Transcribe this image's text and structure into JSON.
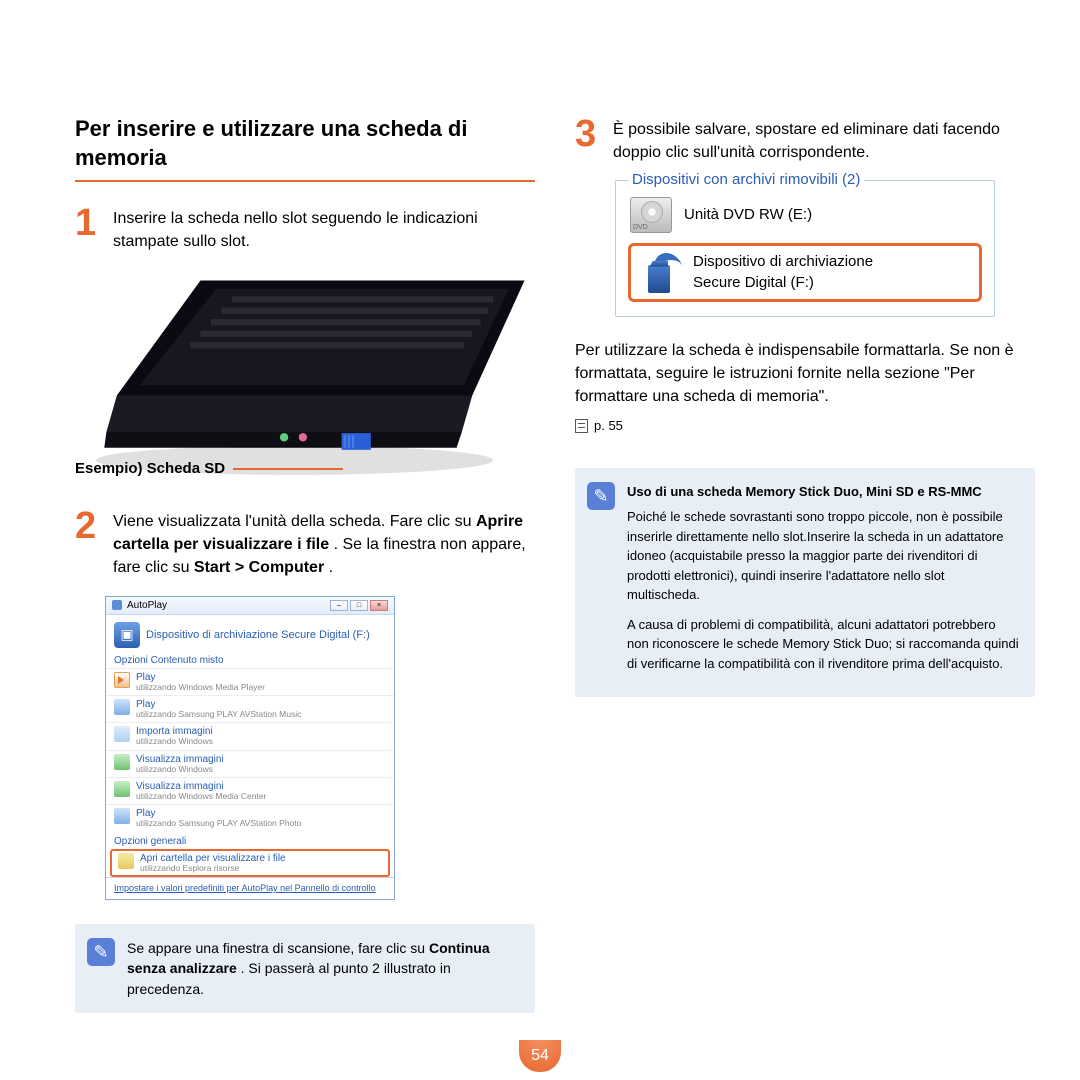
{
  "left": {
    "section_title": "Per inserire e utilizzare una scheda di memoria",
    "step1_num": "1",
    "step1_text": "Inserire la scheda nello slot seguendo le indicazioni stampate sullo slot.",
    "sd_example_label": "Esempio) Scheda SD",
    "step2_num": "2",
    "step2_pre": "Viene visualizzata l'unità della scheda. Fare clic su ",
    "step2_bold1": "Aprire cartella per visualizzare i file",
    "step2_mid": ". Se la finestra non appare, fare clic su ",
    "step2_bold2": "Start > Computer",
    "step2_end": ".",
    "autoplay": {
      "window_title": "AutoPlay",
      "device": "Dispositivo di archiviazione Secure Digital (F:)",
      "mixed_label": "Opzioni Contenuto misto",
      "items": [
        {
          "t": "Play",
          "s": "utilizzando Windows Media Player"
        },
        {
          "t": "Play",
          "s": "utilizzando Samsung PLAY AVStation Music"
        },
        {
          "t": "Importa immagini",
          "s": "utilizzando Windows"
        },
        {
          "t": "Visualizza immagini",
          "s": "utilizzando Windows"
        },
        {
          "t": "Visualizza immagini",
          "s": "utilizzando Windows Media Center"
        },
        {
          "t": "Play",
          "s": "utilizzando Samsung PLAY AVStation Photo"
        }
      ],
      "general_label": "Opzioni generali",
      "highlight": {
        "t": "Apri cartella per visualizzare i file",
        "s": "utilizzando Esplora risorse"
      },
      "footer_link": "Impostare i valori predefiniti per AutoPlay nel Pannello di controllo"
    },
    "note": {
      "pre": "Se appare una finestra di scansione, fare clic su ",
      "bold": "Continua senza analizzare",
      "post": ". Si passerà al punto 2 illustrato in precedenza."
    }
  },
  "right": {
    "step3_num": "3",
    "step3_text": "È possibile salvare, spostare ed eliminare dati facendo doppio clic sull'unità corrispondente.",
    "removable": {
      "legend": "Dispositivi con archivi rimovibili (2)",
      "dvd": "Unità DVD RW (E:)",
      "sd_line1": "Dispositivo di archiviazione",
      "sd_line2": "Secure Digital (F:)"
    },
    "para1": "Per utilizzare la scheda è indispensabile formattarla. Se non è formattata, seguire le istruzioni fornite nella sezione \"Per formattare una scheda di memoria\".",
    "pageref": "p. 55",
    "note2": {
      "title": "Uso di una scheda Memory Stick Duo, Mini SD e RS-MMC",
      "p1": "Poiché le schede sovrastanti sono troppo piccole, non è possibile inserirle direttamente nello slot.Inserire la scheda in un adattatore idoneo (acquistabile presso la maggior parte dei rivenditori di prodotti elettronici), quindi inserire l'adattatore nello slot multischeda.",
      "p2": "A causa di problemi di compatibilità, alcuni adattatori potrebbero non riconoscere le schede Memory Stick Duo; si raccomanda quindi di verificarne la compatibilità con il rivenditore prima dell'acquisto."
    }
  },
  "page_number": "54"
}
